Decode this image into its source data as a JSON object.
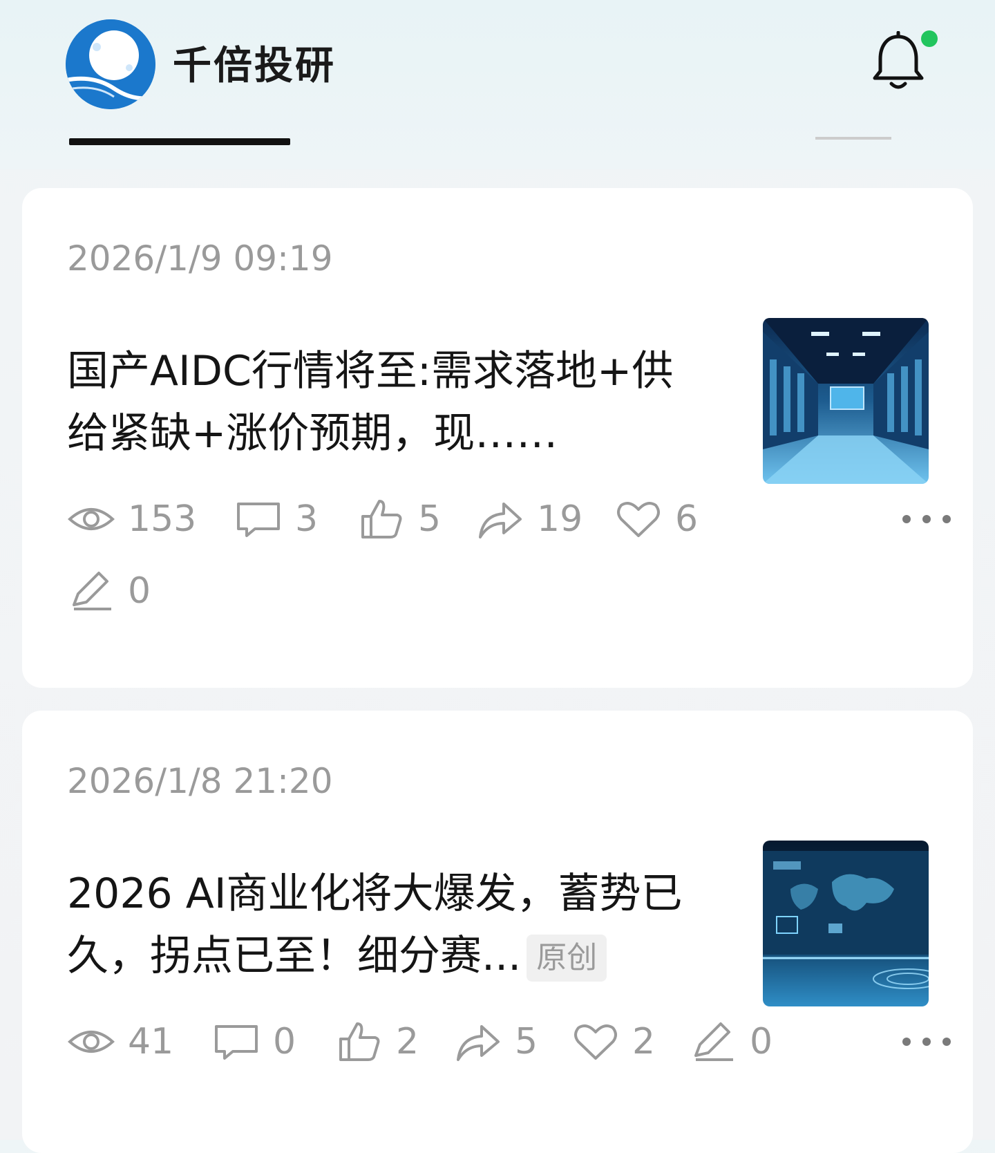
{
  "header": {
    "app_title": "千倍投研",
    "notification_dot_color": "#22c55e",
    "accent_color": "#1b78cc"
  },
  "posts": [
    {
      "date": "2026/1/9 09:19",
      "title": "国产AIDC行情将至:需求落地+供给紧缺+涨价预期，现……",
      "badge": "",
      "thumbnail": "data-center-server-room",
      "stats": {
        "views": "153",
        "comments": "3",
        "likes": "5",
        "shares": "19",
        "favorites": "6",
        "edits": "0"
      }
    },
    {
      "date": "2026/1/8 21:20",
      "title": "2026 AI商业化将大爆发，蓄势已久，拐点已至！细分赛...",
      "badge": "原创",
      "thumbnail": "tech-world-map-screens",
      "stats": {
        "views": "41",
        "comments": "0",
        "likes": "2",
        "shares": "5",
        "favorites": "2",
        "edits": "0"
      }
    }
  ]
}
